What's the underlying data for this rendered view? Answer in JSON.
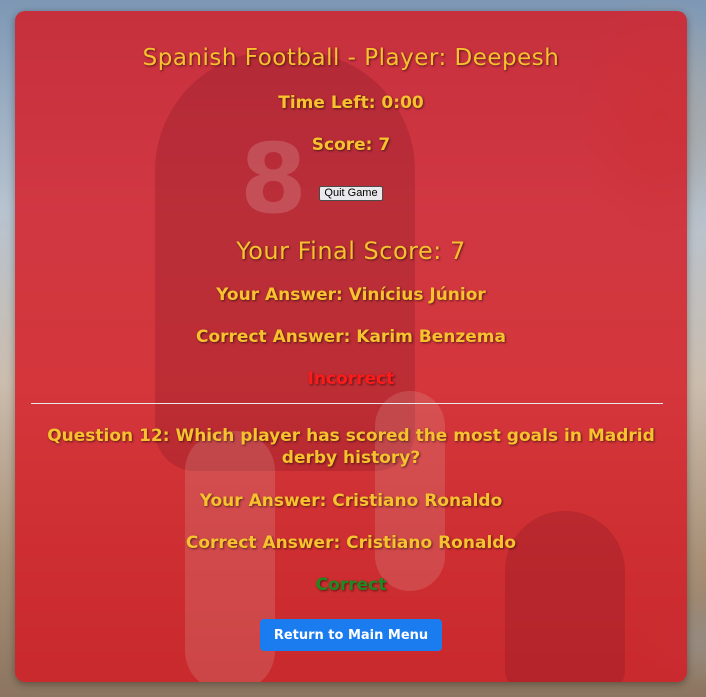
{
  "header": {
    "title": "Spanish Football - Player: Deepesh",
    "time_left": "Time Left: 0:00",
    "score": "Score: 7"
  },
  "controls": {
    "quit_label": "Quit Game",
    "return_label": "Return to Main Menu"
  },
  "final_score": "Your Final Score: 7",
  "results": [
    {
      "your_answer": "Your Answer: Vinícius Júnior",
      "correct_answer": "Correct Answer: Karim Benzema",
      "verdict": "Incorrect"
    },
    {
      "question": "Question 12: Which player has scored the most goals in Madrid derby history?",
      "your_answer": "Your Answer: Cristiano Ronaldo",
      "correct_answer": "Correct Answer: Cristiano Ronaldo",
      "verdict": "Correct"
    }
  ],
  "colors": {
    "card_overlay": "#d61822",
    "text_gold": "#f7c22e",
    "incorrect": "#ff1a1a",
    "correct": "#1f8a1f",
    "button_blue": "#1b7cf0"
  },
  "background_image": "anime-football-player-stadium"
}
